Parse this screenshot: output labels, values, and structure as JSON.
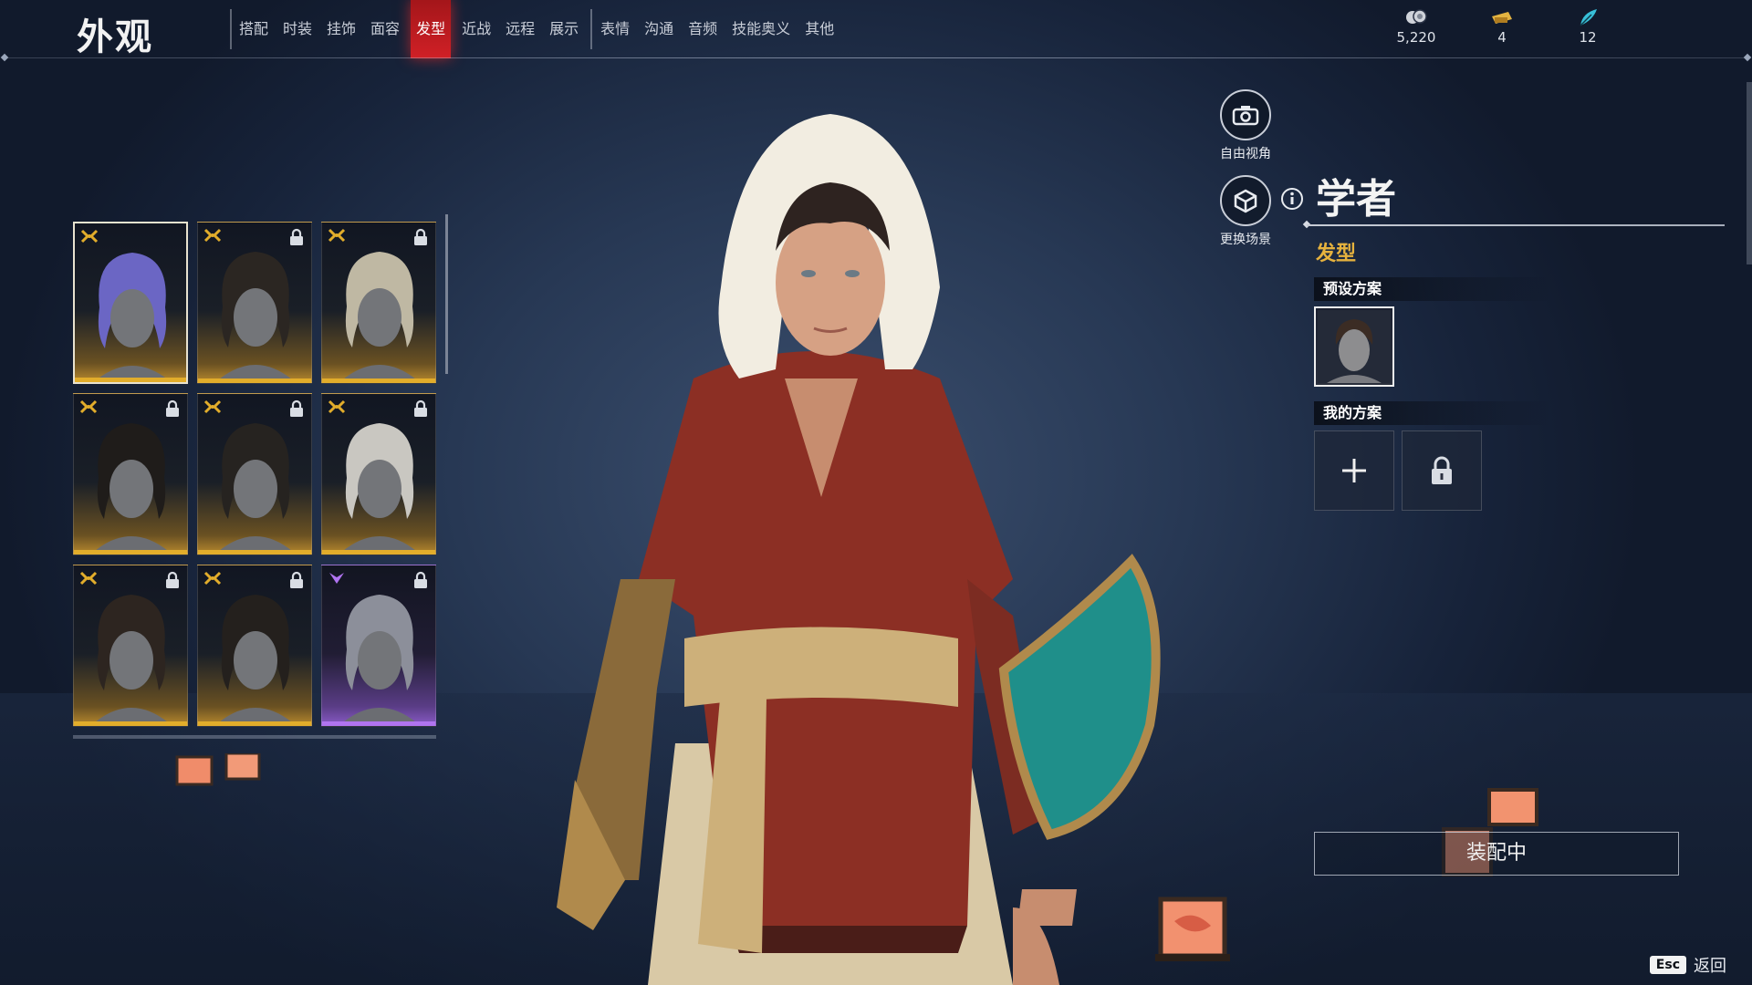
{
  "header": {
    "title": "外观",
    "tabs_group1": [
      "搭配",
      "时装",
      "挂饰",
      "面容",
      "发型",
      "近战",
      "远程",
      "展示"
    ],
    "tabs_group2": [
      "表情",
      "沟通",
      "音频",
      "技能奥义",
      "其他"
    ],
    "active_tab": "发型"
  },
  "currencies": [
    {
      "icon": "silver-coin-icon",
      "value": "5,220",
      "color": "#cfd3da"
    },
    {
      "icon": "ticket-icon",
      "value": "4",
      "color": "#e3b341"
    },
    {
      "icon": "feather-icon",
      "value": "12",
      "color": "#38c0d9"
    }
  ],
  "hair_grid": {
    "items": [
      {
        "rarity": "gold",
        "locked": false,
        "selected": true,
        "hair_color": "#6b66c4"
      },
      {
        "rarity": "gold",
        "locked": true,
        "selected": false,
        "hair_color": "#2b2622"
      },
      {
        "rarity": "gold",
        "locked": true,
        "selected": false,
        "hair_color": "#bfb8a3"
      },
      {
        "rarity": "gold",
        "locked": true,
        "selected": false,
        "hair_color": "#1f1c1a"
      },
      {
        "rarity": "gold",
        "locked": true,
        "selected": false,
        "hair_color": "#262320"
      },
      {
        "rarity": "gold",
        "locked": true,
        "selected": false,
        "hair_color": "#c9c7c1"
      },
      {
        "rarity": "gold",
        "locked": true,
        "selected": false,
        "hair_color": "#2d2520"
      },
      {
        "rarity": "gold",
        "locked": true,
        "selected": false,
        "hair_color": "#24201d"
      },
      {
        "rarity": "purple",
        "locked": true,
        "selected": false,
        "hair_color": "#8c8f9a"
      }
    ]
  },
  "side_buttons": {
    "free_camera": "自由视角",
    "change_scene": "更换场景"
  },
  "panel": {
    "preset_name": "学者",
    "category": "发型",
    "preset_section": "预设方案",
    "my_section": "我的方案",
    "equip_label": "装配中"
  },
  "footer": {
    "esc_key": "Esc",
    "back_label": "返回"
  },
  "colors": {
    "accent_red": "#d02026",
    "gold": "#e2ad2b",
    "purple": "#b074f0",
    "section_gold": "#e6b23e"
  }
}
